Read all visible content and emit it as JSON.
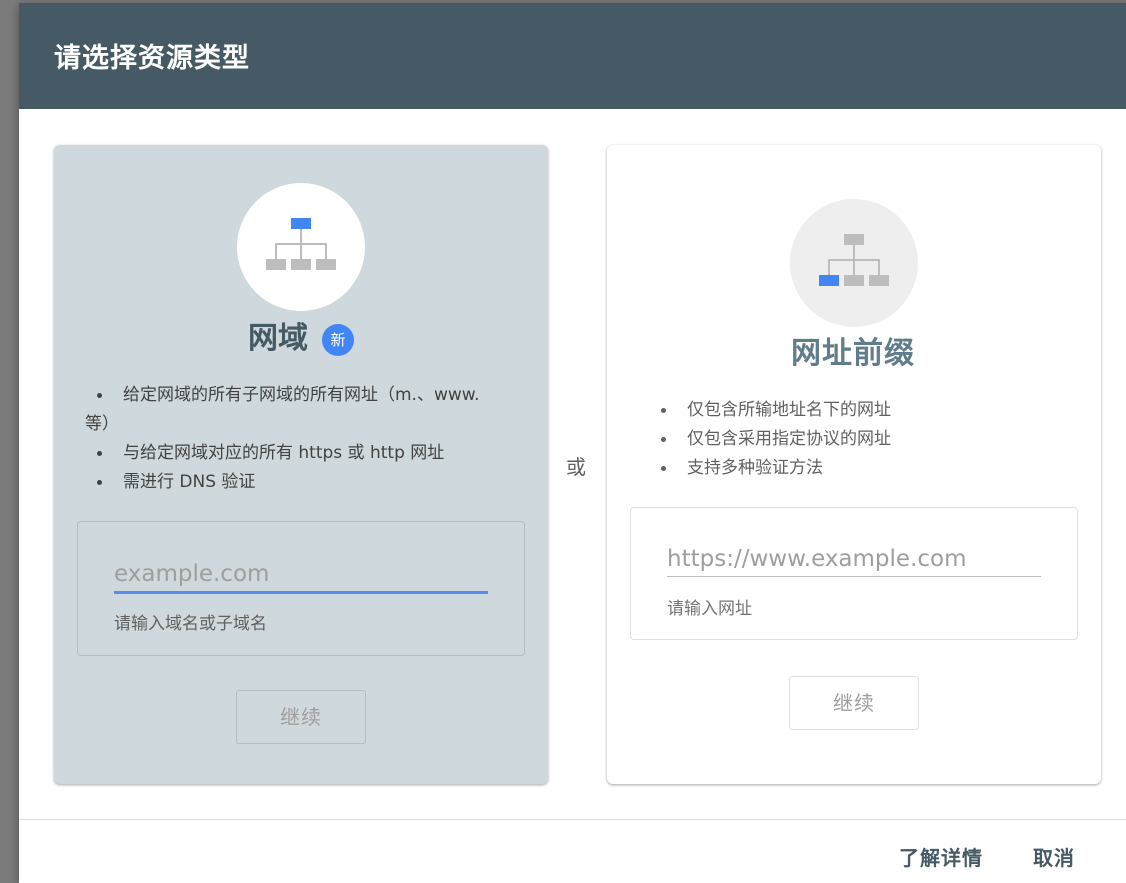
{
  "dialog": {
    "title": "请选择资源类型"
  },
  "domain_card": {
    "heading": "网域",
    "badge": "新",
    "bullets": [
      "给定网域的所有子网域的所有网址（m.、www. 等）",
      "与给定网域对应的所有 https 或 http 网址",
      "需进行 DNS 验证"
    ],
    "input_placeholder": "example.com",
    "input_value": "",
    "helper_text": "请输入域名或子域名",
    "continue_label": "继续",
    "selected": true
  },
  "separator": {
    "or_label": "或"
  },
  "prefix_card": {
    "heading": "网址前缀",
    "bullets": [
      "仅包含所输地址名下的网址",
      "仅包含采用指定协议的网址",
      "支持多种验证方法"
    ],
    "input_placeholder": "https://www.example.com",
    "input_value": "",
    "helper_text": "请输入网址",
    "continue_label": "继续",
    "selected": false
  },
  "footer": {
    "learn_more_label": "了解详情",
    "cancel_label": "取消"
  },
  "colors": {
    "header_bg": "#455a64",
    "selected_card_bg": "#cfd8dc",
    "accent_blue": "#4285f4"
  },
  "icons": {
    "domain_icon": "domain-tree-icon",
    "prefix_icon": "url-prefix-tree-icon"
  }
}
